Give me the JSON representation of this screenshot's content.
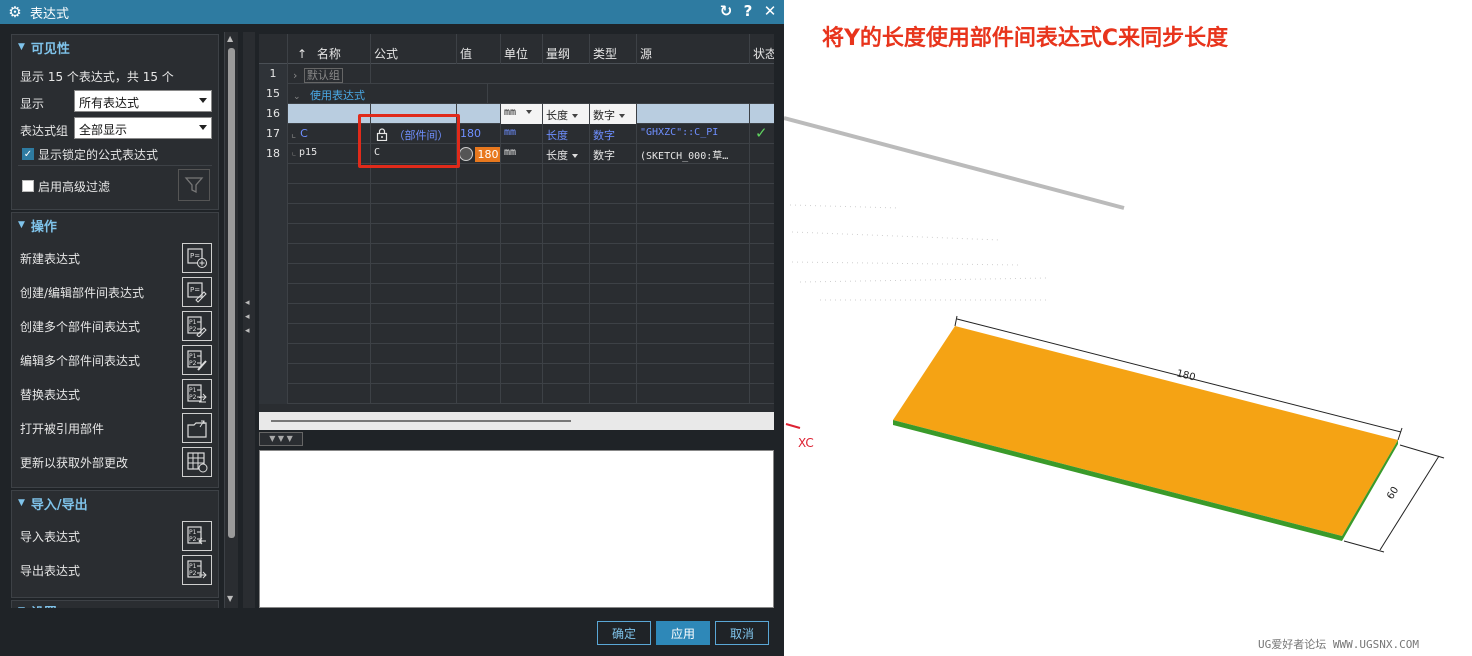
{
  "dialog": {
    "title": "表达式",
    "title_controls": [
      "↻",
      "?",
      "✕"
    ]
  },
  "visibility": {
    "header": "可见性",
    "count_text": "显示 15 个表达式，共 15 个",
    "show_label": "显示",
    "show_value": "所有表达式",
    "group_label": "表达式组",
    "group_value": "全部显示",
    "locked_formula_label": "显示锁定的公式表达式",
    "locked_formula_checked": true,
    "advanced_filter_label": "启用高级过滤",
    "advanced_filter_checked": false
  },
  "operations": {
    "header": "操作",
    "items": [
      {
        "label": "新建表达式",
        "icon": "new-expression-icon"
      },
      {
        "label": "创建/编辑部件间表达式",
        "icon": "interpart-expression-icon"
      },
      {
        "label": "创建多个部件间表达式",
        "icon": "create-multiple-interpart-icon"
      },
      {
        "label": "编辑多个部件间表达式",
        "icon": "edit-multiple-interpart-icon"
      },
      {
        "label": "替换表达式",
        "icon": "replace-expression-icon"
      },
      {
        "label": "打开被引用部件",
        "icon": "open-referenced-part-icon"
      },
      {
        "label": "更新以获取外部更改",
        "icon": "update-external-icon"
      }
    ]
  },
  "import_export": {
    "header": "导入/导出",
    "items": [
      {
        "label": "导入表达式",
        "icon": "import-expression-icon"
      },
      {
        "label": "导出表达式",
        "icon": "export-expression-icon"
      }
    ]
  },
  "settings": {
    "header": "设置"
  },
  "grid": {
    "columns": [
      "",
      "名称",
      "公式",
      "值",
      "单位",
      "量纲",
      "类型",
      "源",
      "状态"
    ],
    "sort_arrow": "↑",
    "rows": [
      {
        "n": "1",
        "name": "默认组"
      },
      {
        "n": "15",
        "name": "使用表达式"
      },
      {
        "n": "16",
        "unit": "mm",
        "dim": "长度",
        "type": "数字"
      },
      {
        "n": "17",
        "name": "C",
        "formula": "（部件间）",
        "value": "180",
        "unit": "mm",
        "dim": "长度",
        "type": "数字",
        "source": "\"GHXZC\"::C_PI",
        "status": "✓"
      },
      {
        "n": "18",
        "name": "p15",
        "formula": "C",
        "value": "180",
        "unit": "mm",
        "dim": "长度",
        "type": "数字",
        "source": "(SKETCH_000:草…"
      }
    ]
  },
  "buttons": {
    "ok": "确定",
    "apply": "应用",
    "cancel": "取消"
  },
  "viewport": {
    "caption": "将Y的长度使用部件间表达式C来同步长度",
    "axis_label": "XC",
    "dim_length": "180",
    "dim_width": "60",
    "plate_color": "#f5a314",
    "edge_color": "#3a9a2a",
    "watermark": "UG爱好者论坛 WWW.UGSNX.COM"
  }
}
